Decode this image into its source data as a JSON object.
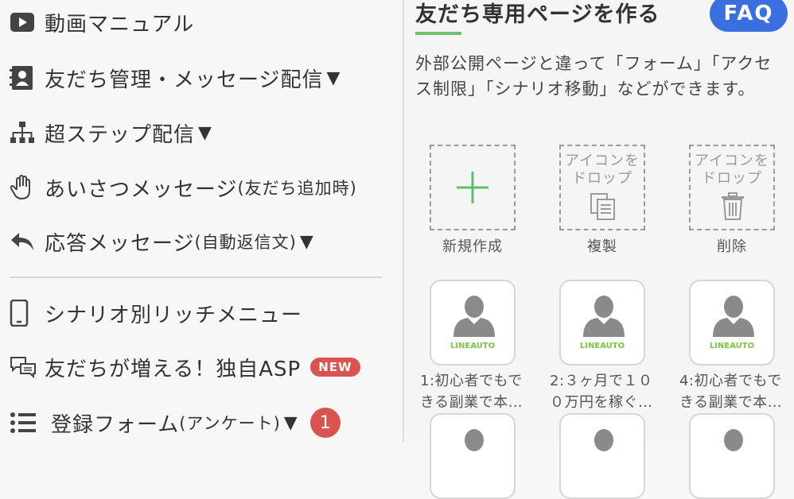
{
  "menu": {
    "items": [
      {
        "label": "動画マニュアル",
        "icon": "video-play-icon"
      },
      {
        "label": "友だち管理・メッセージ配信",
        "arrow": "▼",
        "icon": "contact-book-icon"
      },
      {
        "label": "超ステップ配信",
        "arrow": "▼",
        "icon": "hierarchy-icon"
      },
      {
        "label": "あいさつメッセージ",
        "sub": "(友だち追加時)",
        "icon": "hand-icon"
      },
      {
        "label": "応答メッセージ",
        "sub": "(自動返信文)",
        "arrow": "▼",
        "icon": "reply-arrow-icon"
      },
      {
        "label": "シナリオ別リッチメニュー",
        "icon": "smartphone-icon"
      },
      {
        "label": "友だちが増える！独自ASP",
        "badge": "NEW",
        "icon": "chat-bubbles-icon"
      },
      {
        "label": "登録フォーム",
        "sub": "(アンケート)",
        "arrow": "▼",
        "count": "1",
        "icon": "list-icon"
      }
    ]
  },
  "panel": {
    "title": "友だち専用ページを作る",
    "faq_label": "FAQ",
    "description": "外部公開ページと違って「フォーム」「アクセス制限」「シナリオ移動」などができます。",
    "actions": [
      {
        "caption": "新規作成",
        "icon": "plus-icon"
      },
      {
        "text1": "アイコンを",
        "text2": "ドロップ",
        "caption": "複製",
        "icon": "copy-icon"
      },
      {
        "text1": "アイコンを",
        "text2": "ドロップ",
        "caption": "削除",
        "icon": "trash-icon"
      }
    ],
    "cards": [
      {
        "line1": "1:初心者でもで",
        "line2": "きる副業で本…",
        "brand": "LINEAUTO"
      },
      {
        "line1": "2:３ヶ月で１０",
        "line2": "０万円を稼ぐ…",
        "brand": "LINEAUTO"
      },
      {
        "line1": "4:初心者でもで",
        "line2": "きる副業で本…",
        "brand": "LINEAUTO"
      }
    ]
  },
  "colors": {
    "accent_green": "#6cc070",
    "faq_blue": "#3a6fe0",
    "badge_red": "#d9534f"
  }
}
